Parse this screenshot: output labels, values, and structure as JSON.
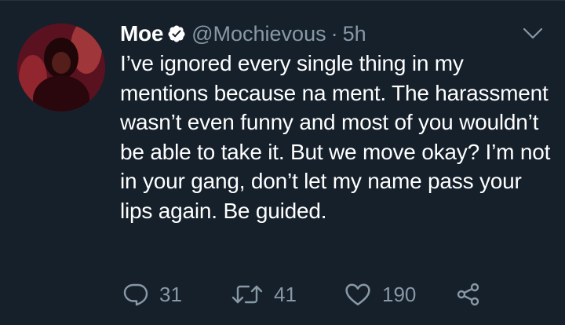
{
  "tweet": {
    "display_name": "Moe",
    "handle": "@Mochievous",
    "separator": "·",
    "time": "5h",
    "text": "I’ve ignored every single thing in my mentions because na ment. The harassment wasn’t even funny and most of you wouldn’t be able to take it. But we move okay? I’m not in your gang, don’t let my name pass your lips again. Be guided.",
    "actions": {
      "reply_count": "31",
      "retweet_count": "41",
      "like_count": "190"
    },
    "icons": {
      "verified": "verified-badge-icon",
      "caret": "chevron-down-icon",
      "reply": "reply-icon",
      "retweet": "retweet-icon",
      "like": "heart-icon",
      "share": "share-icon"
    }
  },
  "colors": {
    "background": "#15202b",
    "text": "#ffffff",
    "secondary": "#8899a6"
  }
}
